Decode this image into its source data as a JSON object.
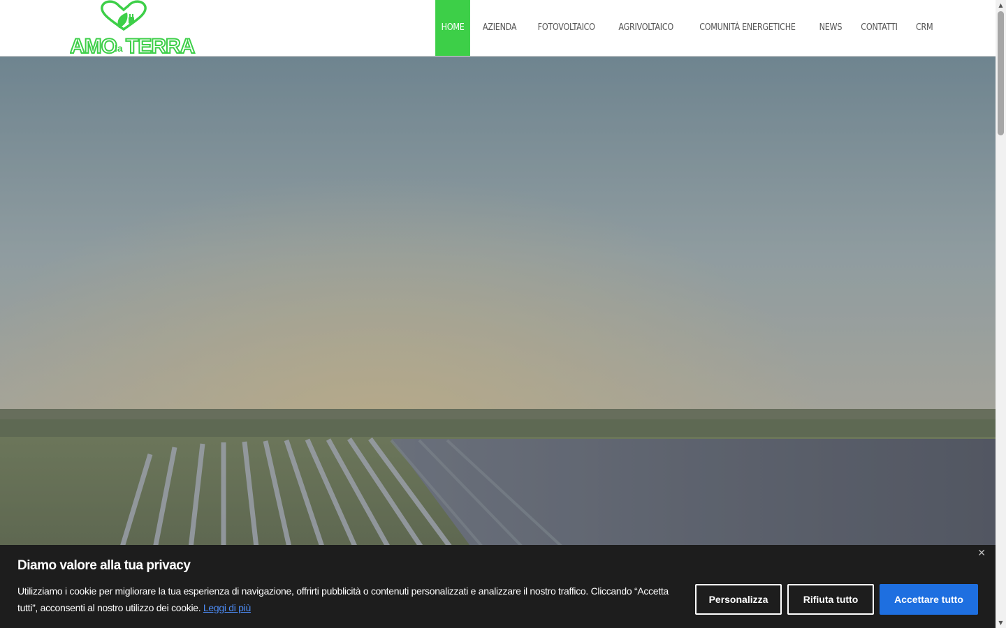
{
  "header": {
    "logo_text": "AMO la TERRA",
    "nav": [
      {
        "label": "HOME",
        "active": true
      },
      {
        "label": "AZIENDA"
      },
      {
        "label": "FOTOVOLTAICO"
      },
      {
        "label": "AGRIVOLTAICO"
      },
      {
        "label": "COMUNITÀ ENERGETICHE"
      },
      {
        "label": "NEWS"
      },
      {
        "label": "CONTATTI"
      },
      {
        "label": "CRM"
      }
    ]
  },
  "hero": {
    "headline": "",
    "subtitle": ""
  },
  "cookie": {
    "title": "Diamo valore alla tua privacy",
    "text": "Utilizziamo i cookie per migliorare la tua esperienza di navigazione, offrirti pubblicità o contenuti personalizzati e analizzare il nostro traffico. Cliccando “Accetta tutti”, acconsenti al nostro utilizzo dei cookie.",
    "read_more": "Leggi di più",
    "customize": "Personalizza",
    "reject": "Rifiuta tutto",
    "accept": "Accettare tutto",
    "close_icon": "close-icon"
  },
  "colors": {
    "brand_green": "#3dcf48",
    "accept_blue": "#1e6fe0",
    "banner_bg": "#1d1d1d"
  }
}
